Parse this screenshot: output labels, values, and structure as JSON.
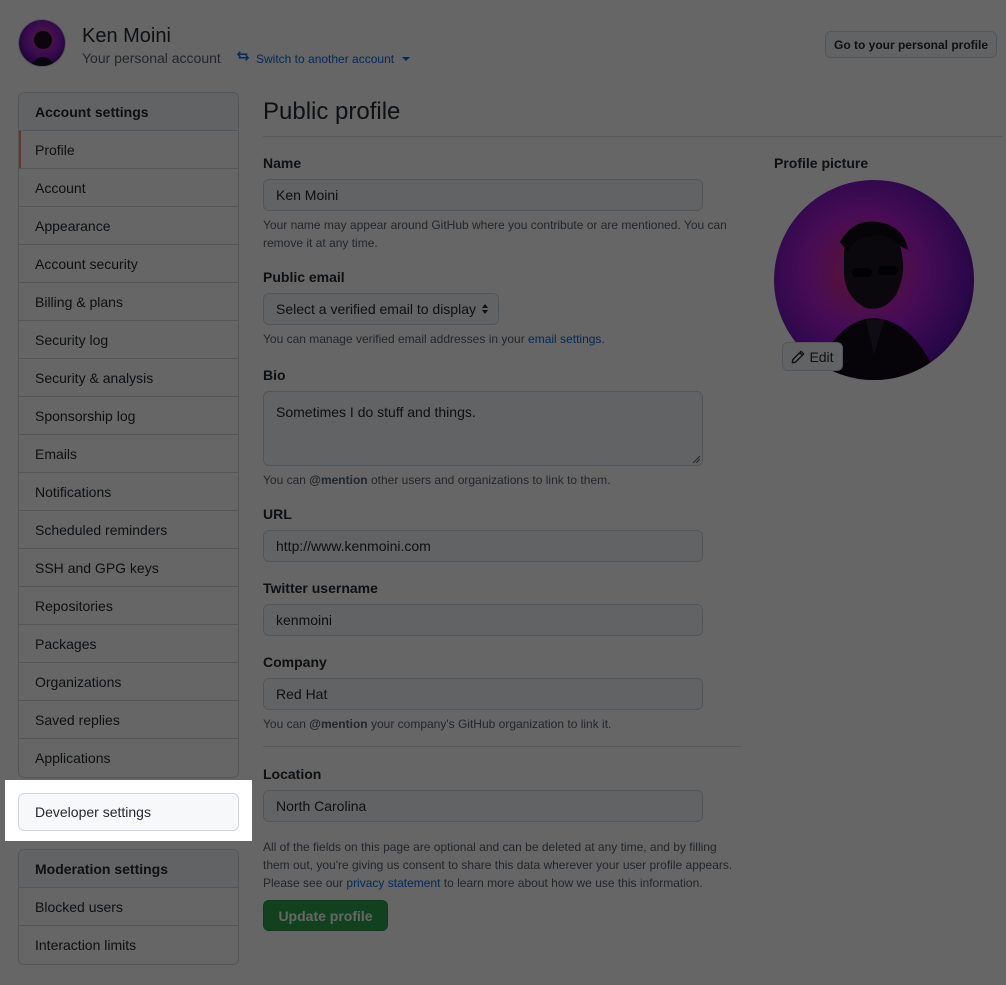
{
  "header": {
    "user_name": "Ken Moini",
    "account_type": "Your personal account",
    "switch_account": "Switch to another account",
    "go_to_profile": "Go to your personal profile"
  },
  "sidebar": {
    "account_settings": {
      "heading": "Account settings",
      "items": [
        "Profile",
        "Account",
        "Appearance",
        "Account security",
        "Billing & plans",
        "Security log",
        "Security & analysis",
        "Sponsorship log",
        "Emails",
        "Notifications",
        "Scheduled reminders",
        "SSH and GPG keys",
        "Repositories",
        "Packages",
        "Organizations",
        "Saved replies",
        "Applications"
      ],
      "selected": "Profile"
    },
    "developer_settings": "Developer settings",
    "moderation_settings": {
      "heading": "Moderation settings",
      "items": [
        "Blocked users",
        "Interaction limits"
      ]
    }
  },
  "main": {
    "title": "Public profile",
    "name": {
      "label": "Name",
      "value": "Ken Moini",
      "note": "Your name may appear around GitHub where you contribute or are mentioned. You can remove it at any time."
    },
    "public_email": {
      "label": "Public email",
      "selected": "Select a verified email to display",
      "note_prefix": "You can manage verified email addresses in your ",
      "note_link": "email settings",
      "note_suffix": "."
    },
    "bio": {
      "label": "Bio",
      "value": "Sometimes I do stuff and things.",
      "note_prefix": "You can ",
      "note_mention": "@mention",
      "note_suffix": " other users and organizations to link to them."
    },
    "url": {
      "label": "URL",
      "value": "http://www.kenmoini.com"
    },
    "twitter": {
      "label": "Twitter username",
      "value": "kenmoini"
    },
    "company": {
      "label": "Company",
      "value": "Red Hat",
      "note_prefix": "You can ",
      "note_mention": "@mention",
      "note_suffix": " your company's GitHub organization to link it."
    },
    "location": {
      "label": "Location",
      "value": "North Carolina"
    },
    "disclaimer_prefix": "All of the fields on this page are optional and can be deleted at any time, and by filling them out, you're giving us consent to share this data wherever your user profile appears. Please see our ",
    "disclaimer_link": "privacy statement",
    "disclaimer_suffix": " to learn more about how we use this information.",
    "update_button": "Update profile"
  },
  "profile_picture": {
    "label": "Profile picture",
    "edit": "Edit"
  },
  "icons": {
    "switch": "arrow-switch-icon",
    "pencil": "pencil-icon"
  },
  "colors": {
    "accent_link": "#0969da",
    "primary_button": "#2da44e",
    "selected_marker": "#fd8c73",
    "avatar_glow": "#b21fd6"
  }
}
